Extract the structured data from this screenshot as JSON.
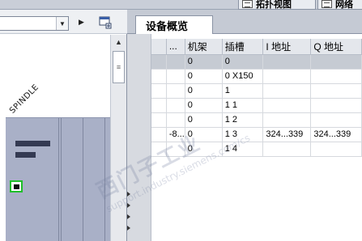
{
  "top_tabs": [
    {
      "label": "拓扑视图",
      "icon": "topology-view-icon"
    },
    {
      "label": "网络",
      "icon": "network-view-icon"
    }
  ],
  "left": {
    "device_label": "SPINDLE",
    "combo_value": "",
    "nav_arrow": "▶",
    "scroll_up": "▲",
    "scroll_thumb": "≡"
  },
  "overview": {
    "tab_label": "设备概览",
    "columns": [
      "",
      "...",
      "机架",
      "插槽",
      "I 地址",
      "Q 地址"
    ],
    "rows": [
      {
        "name": "",
        "module": "",
        "rack": "0",
        "slot": "0",
        "i_addr": "",
        "q_addr": "",
        "selected": true
      },
      {
        "name": "",
        "module": "",
        "rack": "0",
        "slot": "0 X150",
        "i_addr": "",
        "q_addr": ""
      },
      {
        "name": "",
        "module": "",
        "rack": "0",
        "slot": "1",
        "i_addr": "",
        "q_addr": ""
      },
      {
        "name": "",
        "module": "",
        "rack": "0",
        "slot": "1 1",
        "i_addr": "",
        "q_addr": ""
      },
      {
        "name": "",
        "module": "",
        "rack": "0",
        "slot": "1 2",
        "i_addr": "",
        "q_addr": ""
      },
      {
        "name": "",
        "module": "-8...",
        "rack": "0",
        "slot": "1 3",
        "i_addr": "324...339",
        "q_addr": "324...339"
      },
      {
        "name": "",
        "module": "",
        "rack": "0",
        "slot": "1 4",
        "i_addr": "",
        "q_addr": ""
      }
    ]
  },
  "watermark": {
    "line1": "西门子工业",
    "line2": "support.industry.siemens.com/cs"
  }
}
